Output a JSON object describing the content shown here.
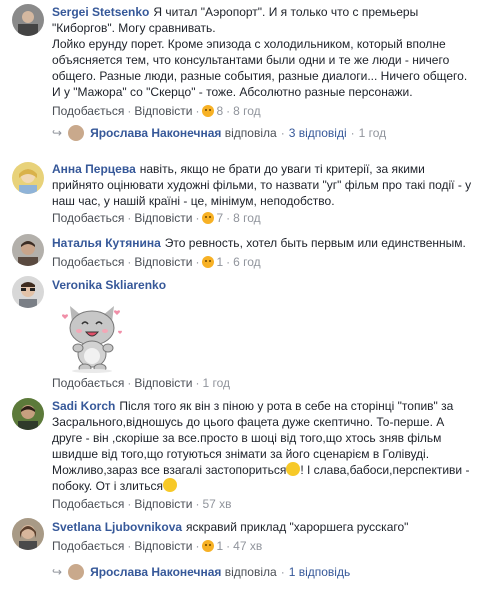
{
  "comments": [
    {
      "author": "Sergei Stetsenko",
      "lines": [
        "Я читал \"Аэропорт\". И я только что с премьеры",
        "\"Киборгов\". Могу сравнивать.",
        "Лойко ерунду порет. Кроме эпизода с холодильником, который вполне",
        "объясняется тем, что консультантами были одни и те же люди - ничего",
        "общего. Разные люди, разные события, разные диалоги... Ничего общего.",
        "И у \"Мажора\" со \"Скерцо\" - тоже. Абсолютно разные персонажи."
      ],
      "like": "Подобається",
      "reply": "Відповісти",
      "reactions": "8",
      "time": "8 год",
      "replies": {
        "name": "Ярослава Наконечная",
        "verb": "відповіла",
        "count": "3 відповіді",
        "time": "1 год"
      }
    },
    {
      "author": "Анна Перцева",
      "lines": [
        "навіть, якщо не брати до уваги ті критерії, за якими",
        "прийнято оцінювати художні фільми, то назвати \"уг\" фільм про такі події - у",
        "наш час, у нашій країні - це, мінімум, неподобство."
      ],
      "like": "Подобається",
      "reply": "Відповісти",
      "reactions": "7",
      "time": "8 год"
    },
    {
      "author": "Наталья Кутянина",
      "lines": [
        "Это ревность, хотел быть первым или единственным."
      ],
      "like": "Подобається",
      "reply": "Відповісти",
      "reactions": "1",
      "time": "6 год"
    },
    {
      "author": "Veronika Skliarenko",
      "lines": [],
      "like": "Подобається",
      "reply": "Відповісти",
      "time": "1 год"
    },
    {
      "author": "Sadi Korch",
      "lines": [
        "Після того як він з піною у рота в себе на сторінці \"топив\" за",
        "Засрального,відношусь до цього фацета дуже скептично. То-перше. А",
        "друге - він ,скоріше за все.просто в шоці від того,що хтось зняв фільм",
        "швидше від того,що готуються знімати за його сценарієм в Голівуді.",
        "Можливо,зараз все взагалі застопориться",
        "! І слава,бабоси,перспективи -",
        "побоку. От і злиться"
      ],
      "like": "Подобається",
      "reply": "Відповісти",
      "time": "57 хв"
    },
    {
      "author": "Svetlana Ljubovnikova",
      "lines": [
        "яскравий приклад \"хароршега русскаго\""
      ],
      "like": "Подобається",
      "reply": "Відповісти",
      "reactions": "1",
      "time": "47 хв",
      "replies": {
        "name": "Ярослава Наконечная",
        "verb": "відповіла",
        "count": "1 відповідь"
      }
    }
  ],
  "colors": {
    "link": "#365899",
    "meta": "#90949c",
    "text": "#1d2129"
  }
}
